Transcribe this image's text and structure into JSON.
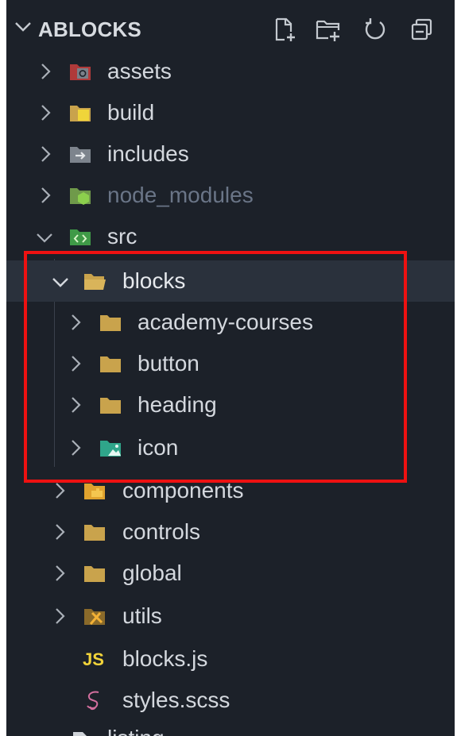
{
  "explorer": {
    "title": "ABLOCKS",
    "actions": [
      {
        "name": "new-file-icon"
      },
      {
        "name": "new-folder-icon"
      },
      {
        "name": "refresh-icon"
      },
      {
        "name": "collapse-all-icon"
      }
    ]
  },
  "tree": {
    "assets": "assets",
    "build": "build",
    "includes": "includes",
    "node_modules": "node_modules",
    "src": "src",
    "blocks": "blocks",
    "academy_courses": "academy-courses",
    "button": "button",
    "heading": "heading",
    "icon": "icon",
    "components": "components",
    "controls": "controls",
    "global": "global",
    "utils": "utils",
    "blocks_js": "blocks.js",
    "styles_scss": "styles.scss",
    "partial_item": "listing"
  },
  "badges": {
    "js": "JS"
  },
  "colors": {
    "sidebar_bg": "#1c2129",
    "selected_bg": "#2a313c",
    "folder": "#c9a34c",
    "highlight_box": "#ee1111"
  }
}
